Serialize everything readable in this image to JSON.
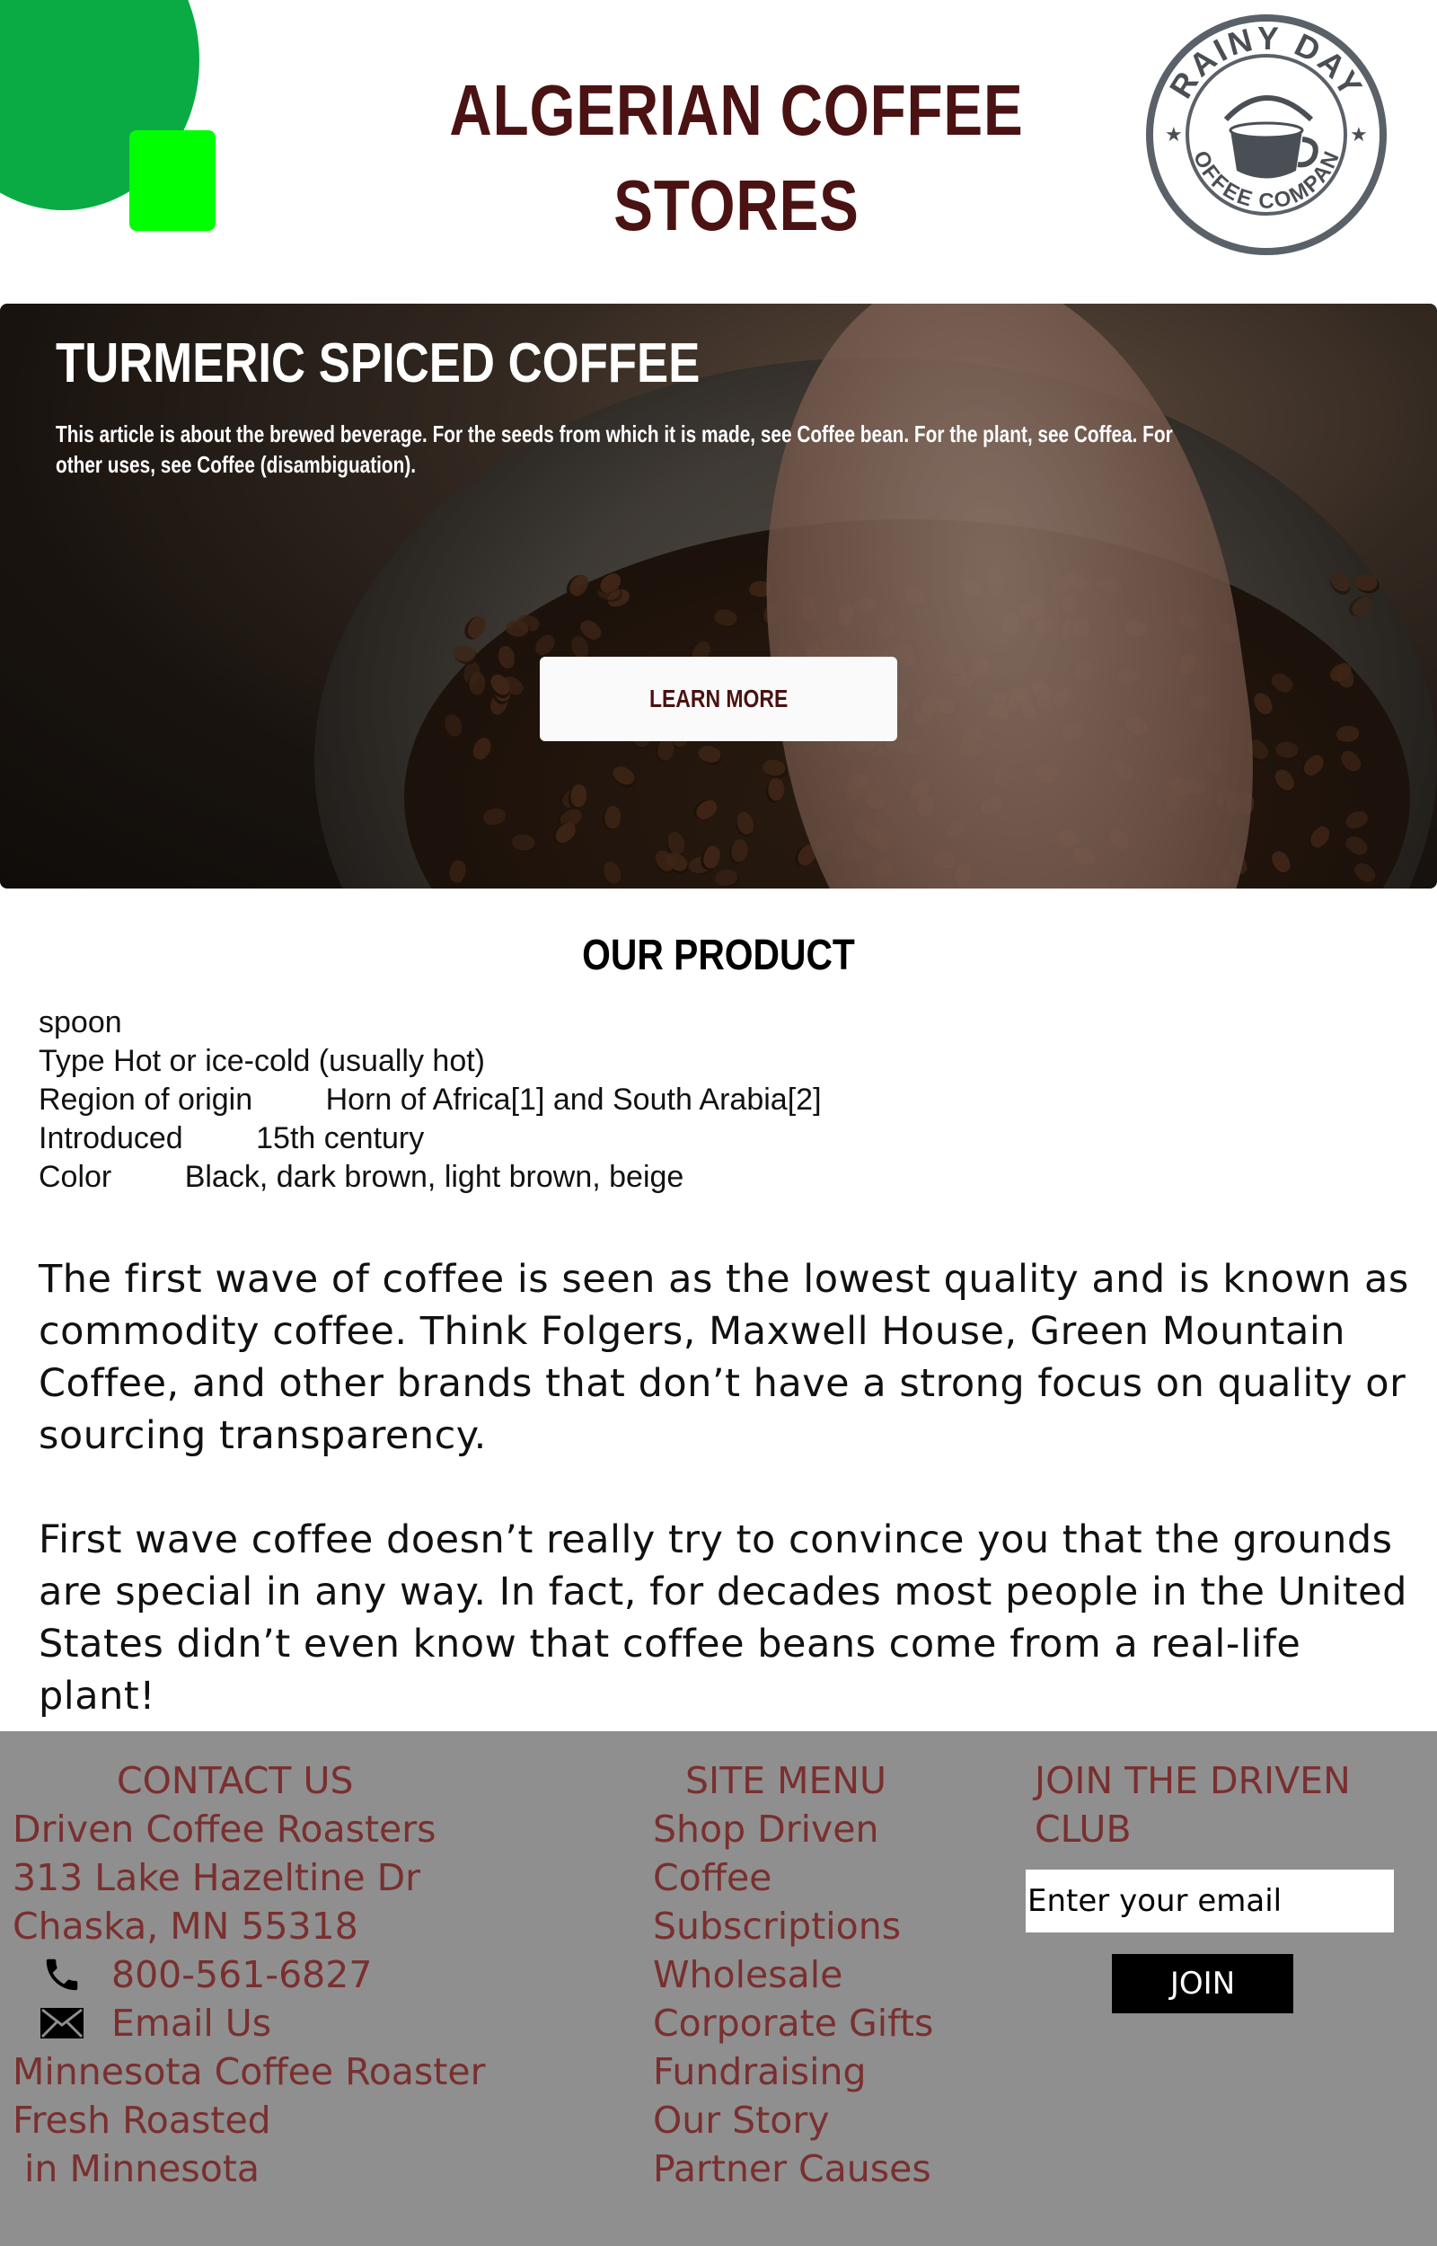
{
  "header": {
    "title": "ALGERIAN  COFFEE STORES",
    "logo": {
      "icon": "coffee-cup-logo-icon",
      "text_top": "RAINY DAY",
      "text_bottom": "COFFEE COMPANY"
    },
    "colors": {
      "title": "#4a1212",
      "circle": "#0aab45",
      "square": "#00ff00"
    }
  },
  "hero": {
    "title": "TURMERIC SPICED COFFEE",
    "description": "This article is about the brewed beverage. For the seeds from which it is made, see Coffee bean. For the plant, see Coffea. For other uses, see Coffee (disambiguation).",
    "button_label": "LEARN MORE"
  },
  "product": {
    "heading": "OUR PRODUCT",
    "intro": "spoon",
    "specs": [
      {
        "key": "Type",
        "value": "Hot or ice-cold (usually hot)"
      },
      {
        "key": "Region of origin",
        "value": "Horn of Africa[1] and South Arabia[2]"
      },
      {
        "key": "Introduced",
        "value": "15th century"
      },
      {
        "key": "Color",
        "value": "Black, dark brown, light brown, beige"
      }
    ],
    "paragraphs": [
      "The first wave of coffee is seen as the lowest quality and is known as commodity coffee. Think Folgers, Maxwell House, Green Mountain Coffee, and other brands that don’t have a strong focus on quality or sourcing transparency.",
      "First wave coffee doesn’t really try to convince you that the grounds are special in any way. In fact, for decades most people in the United States didn’t even know that coffee beans come from a real-life plant!"
    ]
  },
  "footer": {
    "contact": {
      "heading": "CONTACT US",
      "name": "Driven Coffee Roasters",
      "street": "313 Lake Hazeltine Dr",
      "city": "Chaska, MN 55318",
      "phone": "800-561-6827",
      "phone_icon": "phone-icon",
      "email_label": "Email Us",
      "email_icon": "envelope-icon",
      "tagline_1": "Minnesota Coffee Roaster",
      "tagline_2": "Fresh Roasted",
      "tagline_3": " in Minnesota"
    },
    "menu": {
      "heading": "SITE MENU",
      "items": [
        "Shop Driven",
        "Coffee",
        "Subscriptions",
        "Wholesale",
        "Corporate Gifts",
        "Fundraising",
        "Our Story",
        "Partner Causes"
      ]
    },
    "join": {
      "heading_1": "JOIN THE DRIVEN",
      "heading_2": "CLUB",
      "email_placeholder": "Enter your email",
      "button_label": "JOIN"
    },
    "colors": {
      "background": "#8f8f8f",
      "text": "#7a2f2f"
    }
  }
}
